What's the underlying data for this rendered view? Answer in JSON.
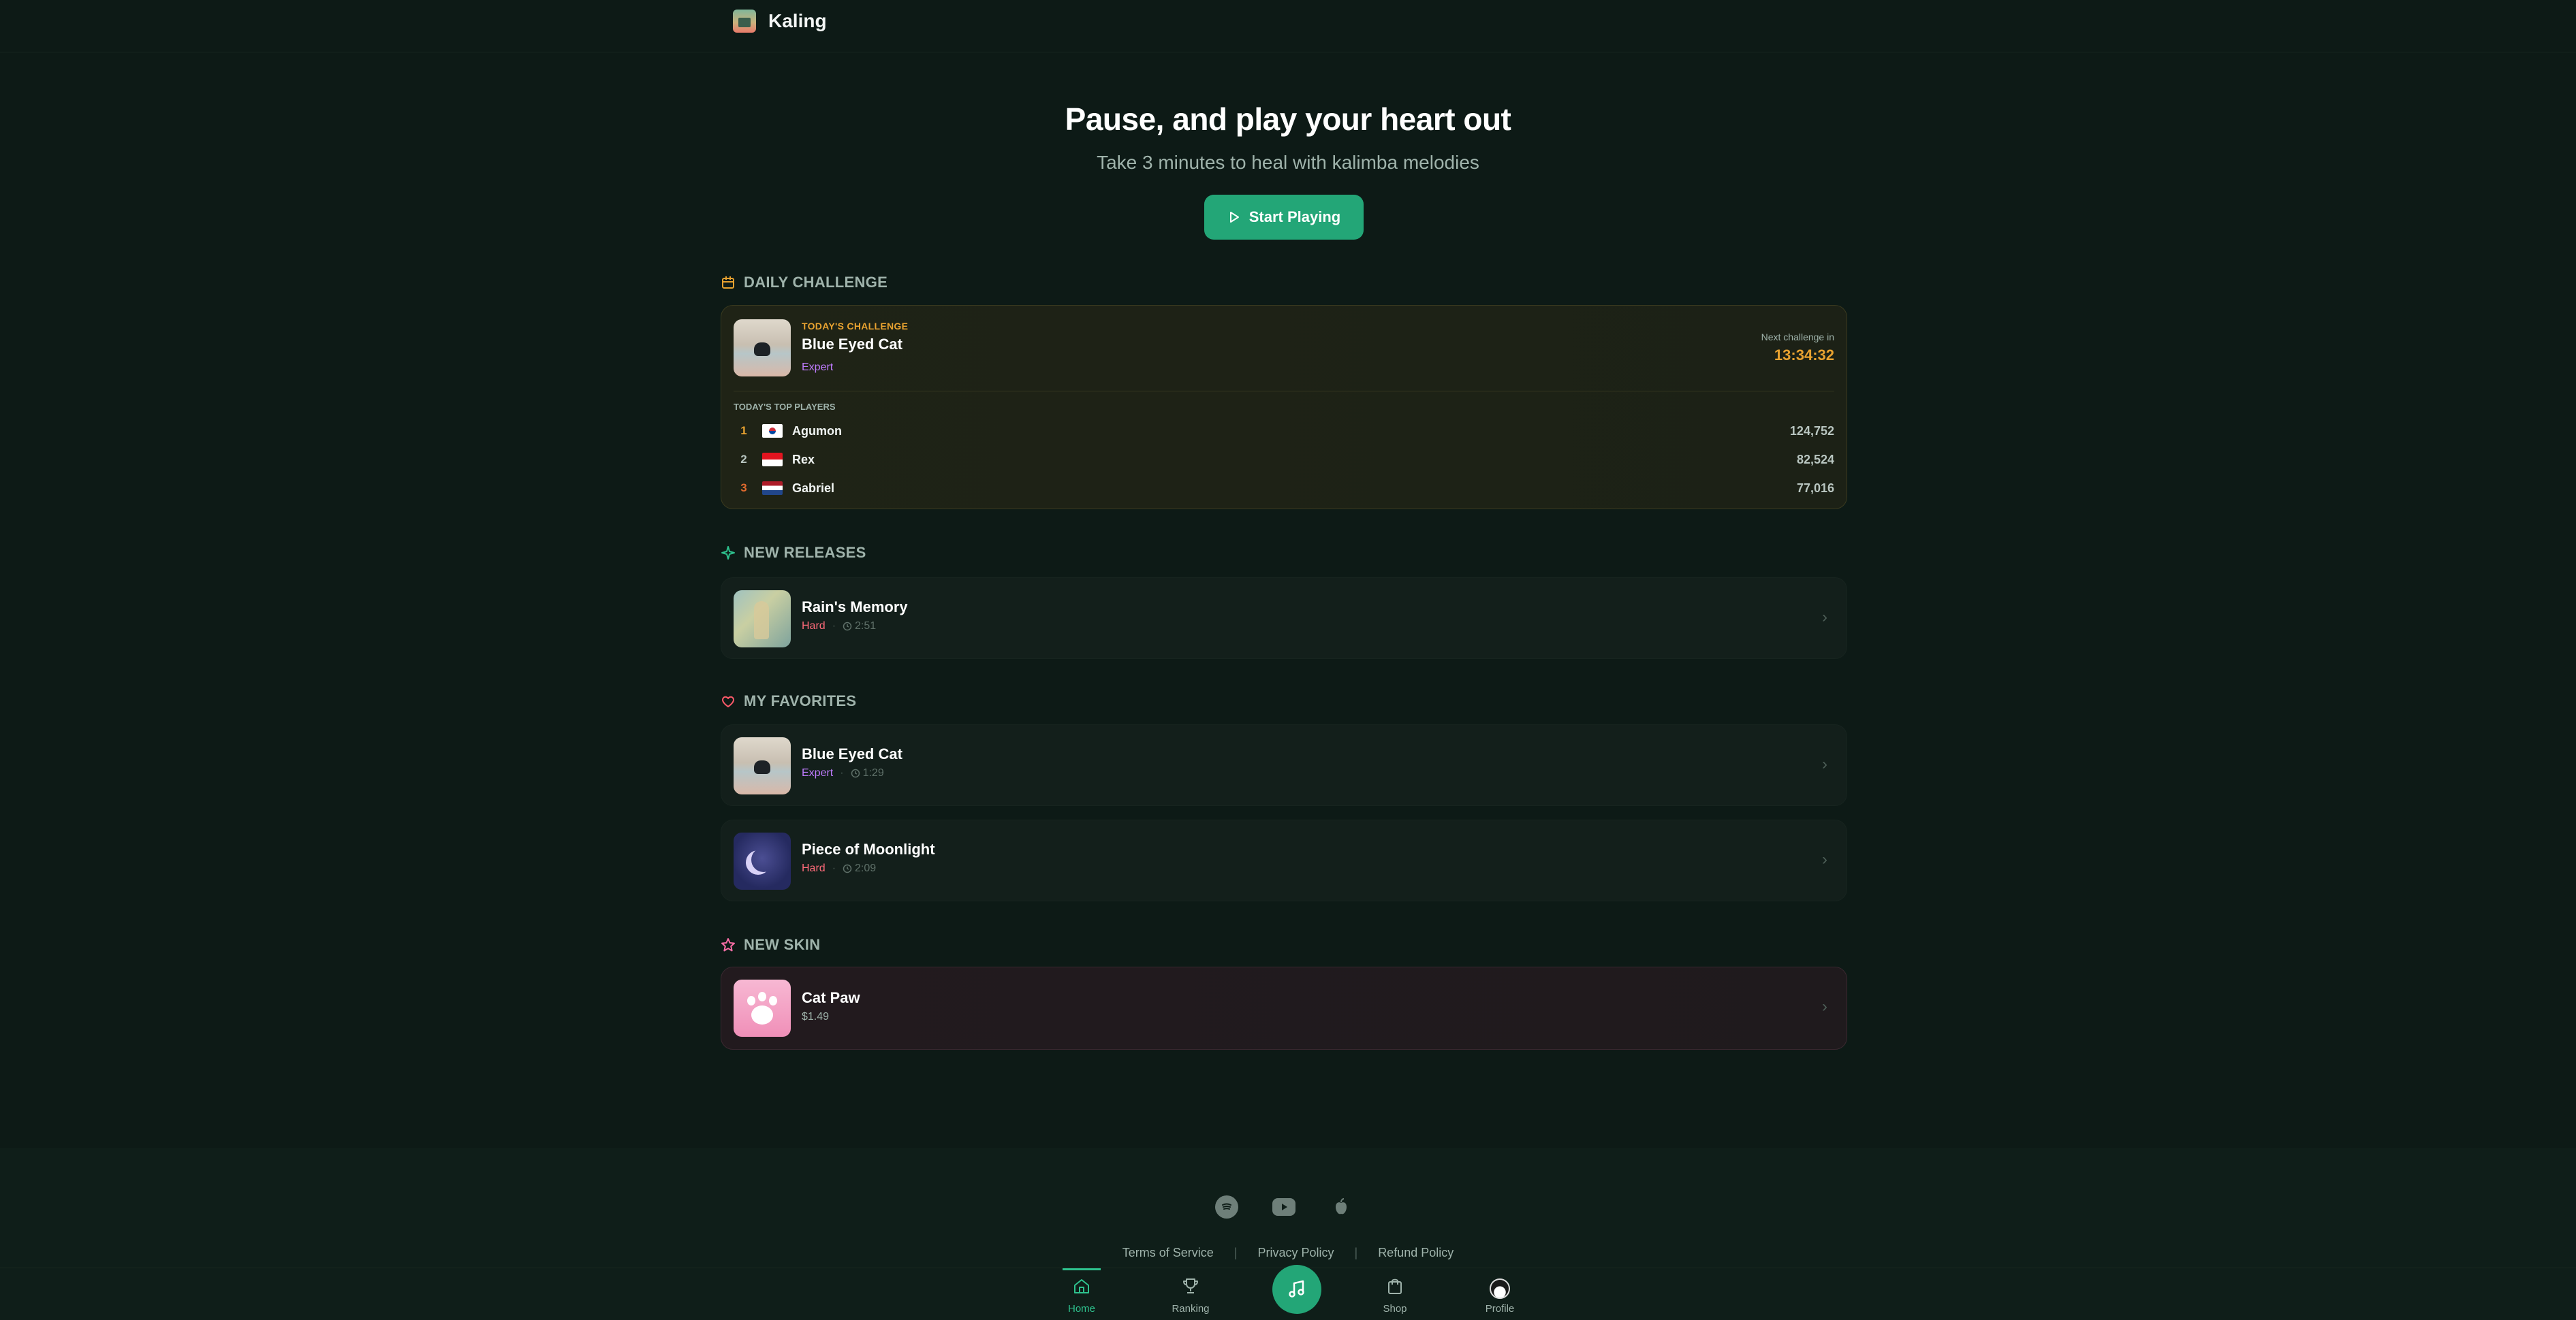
{
  "app": {
    "name": "Kaling"
  },
  "hero": {
    "title": "Pause, and play your heart out",
    "subtitle": "Take 3 minutes to heal with kalimba melodies",
    "cta_label": "Start Playing"
  },
  "daily": {
    "section_title": "DAILY CHALLENGE",
    "badge": "TODAY'S CHALLENGE",
    "song_title": "Blue Eyed Cat",
    "difficulty": "Expert",
    "next_label": "Next challenge in",
    "timer": "13:34:32",
    "top_players_label": "TODAY'S TOP PLAYERS",
    "players": [
      {
        "rank": "1",
        "name": "Agumon",
        "score": "124,752",
        "flag": "kr-flag-icon",
        "rank_color": "#e8a230"
      },
      {
        "rank": "2",
        "name": "Rex",
        "score": "82,524",
        "flag": "id-flag-icon",
        "rank_color": "#b9c6c1"
      },
      {
        "rank": "3",
        "name": "Gabriel",
        "score": "77,016",
        "flag": "nl-flag-icon",
        "rank_color": "#e06a2e"
      }
    ]
  },
  "new_releases": {
    "section_title": "NEW RELEASES",
    "items": [
      {
        "title": "Rain's Memory",
        "difficulty": "Hard",
        "duration": "2:51"
      }
    ]
  },
  "favorites": {
    "section_title": "MY FAVORITES",
    "items": [
      {
        "title": "Blue Eyed Cat",
        "difficulty": "Expert",
        "duration": "1:29"
      },
      {
        "title": "Piece of Moonlight",
        "difficulty": "Hard",
        "duration": "2:09"
      }
    ]
  },
  "new_skin": {
    "section_title": "NEW SKIN",
    "title": "Cat Paw",
    "price": "$1.49"
  },
  "footer": {
    "social": [
      "spotify-icon",
      "youtube-icon",
      "apple-icon"
    ],
    "links": [
      "Terms of Service",
      "Privacy Policy",
      "Refund Policy"
    ]
  },
  "nav": {
    "items": [
      {
        "label": "Home",
        "icon": "home-icon",
        "active": true
      },
      {
        "label": "Ranking",
        "icon": "trophy-icon"
      },
      {
        "label": "",
        "icon": "music-note-icon"
      },
      {
        "label": "Shop",
        "icon": "shopping-bag-icon"
      },
      {
        "label": "Profile",
        "icon": "avatar-icon"
      }
    ]
  },
  "colors": {
    "background": "#0d1a16",
    "accent": "#23a677",
    "gold": "#e8a230",
    "hard": "#ff6b7a",
    "expert": "#c07cff"
  }
}
